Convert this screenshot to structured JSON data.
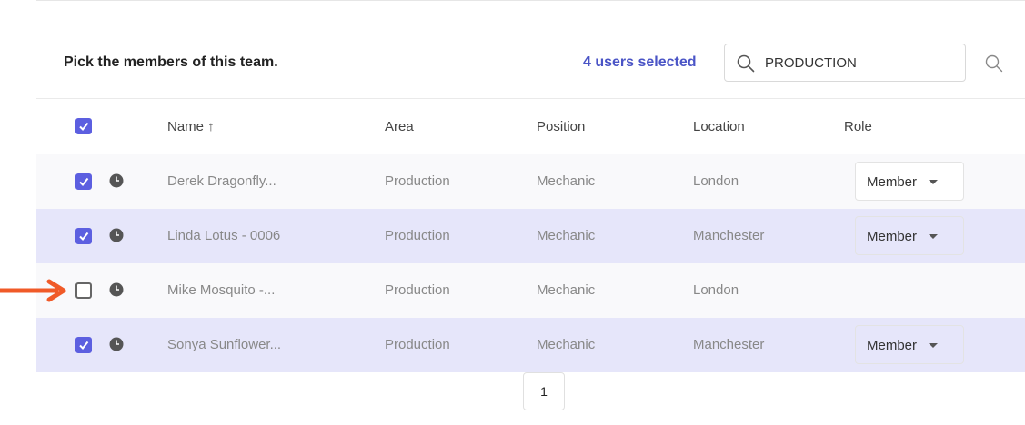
{
  "header": {
    "instruction": "Pick the members of this team.",
    "selected_count": "4 users selected",
    "search": {
      "value": "PRODUCTION",
      "placeholder": ""
    }
  },
  "table": {
    "columns": [
      "Name ↑",
      "Area",
      "Position",
      "Location",
      "Role"
    ],
    "rows": [
      {
        "name": "Derek Dragonfly...",
        "area": "Production",
        "position": "Mechanic",
        "location": "London",
        "role": "Member",
        "checked": true
      },
      {
        "name": "Linda Lotus - 0006",
        "area": "Production",
        "position": "Mechanic",
        "location": "Manchester",
        "role": "Member",
        "checked": true
      },
      {
        "name": "Mike Mosquito -...",
        "area": "Production",
        "position": "Mechanic",
        "location": "London",
        "role": "",
        "checked": false
      },
      {
        "name": "Sonya Sunflower...",
        "area": "Production",
        "position": "Mechanic",
        "location": "Manchester",
        "role": "Member",
        "checked": true
      }
    ]
  },
  "pagination": {
    "current_page": "1"
  },
  "colors": {
    "accent": "#5c5fe0",
    "selected_text": "#4a54c6",
    "row_tint": "#e6e6fa",
    "arrow": "#f05a28"
  },
  "icons": {
    "search": "search-icon",
    "clock": "clock-icon",
    "dropdown": "chevron-down-icon",
    "annotation": "arrow-right-icon"
  }
}
